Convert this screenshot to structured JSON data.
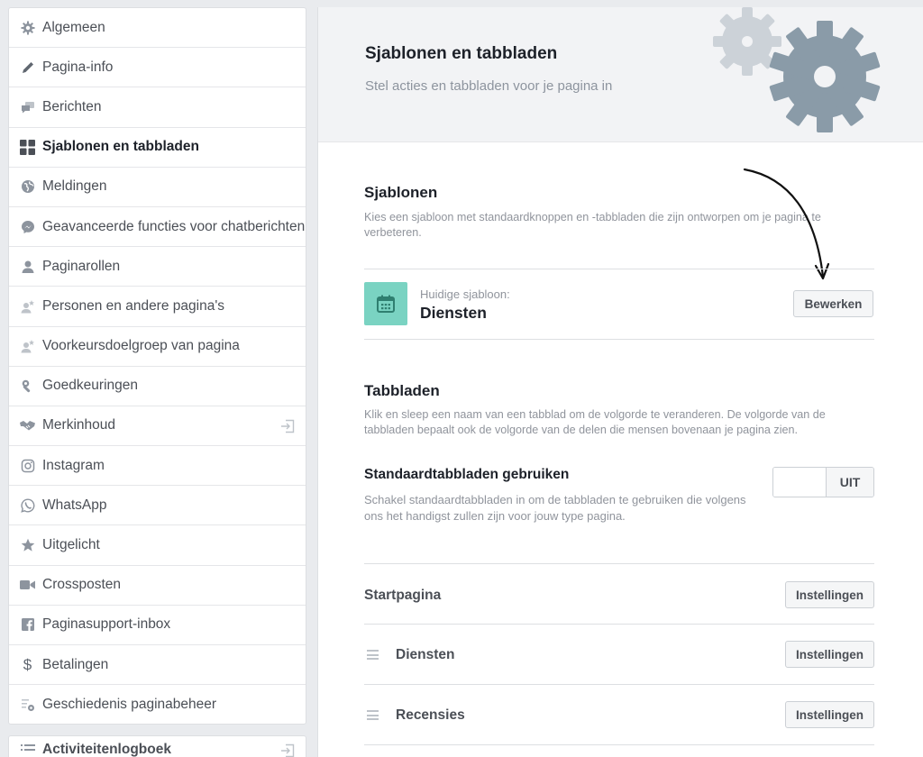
{
  "sidebar": {
    "items": [
      {
        "label": "Algemeen",
        "icon": "gear-icon"
      },
      {
        "label": "Pagina-info",
        "icon": "pencil-icon"
      },
      {
        "label": "Berichten",
        "icon": "chat-bubbles-icon"
      },
      {
        "label": "Sjablonen en tabbladen",
        "icon": "grid-icon",
        "active": true
      },
      {
        "label": "Meldingen",
        "icon": "globe-icon"
      },
      {
        "label": "Geavanceerde functies voor chatberichten",
        "icon": "messenger-icon"
      },
      {
        "label": "Paginarollen",
        "icon": "person-icon"
      },
      {
        "label": "Personen en andere pagina's",
        "icon": "person-star-icon"
      },
      {
        "label": "Voorkeursdoelgroep van pagina",
        "icon": "person-star-icon"
      },
      {
        "label": "Goedkeuringen",
        "icon": "wrench-icon"
      },
      {
        "label": "Merkinhoud",
        "icon": "handshake-icon",
        "trailing_icon": "export-icon"
      },
      {
        "label": "Instagram",
        "icon": "instagram-icon"
      },
      {
        "label": "WhatsApp",
        "icon": "whatsapp-icon"
      },
      {
        "label": "Uitgelicht",
        "icon": "star-icon"
      },
      {
        "label": "Crossposten",
        "icon": "video-camera-icon"
      },
      {
        "label": "Paginasupport-inbox",
        "icon": "facebook-icon"
      },
      {
        "label": "Betalingen",
        "icon": "dollar-icon"
      },
      {
        "label": "Geschiedenis paginabeheer",
        "icon": "history-gear-icon"
      }
    ],
    "secondary": {
      "label": "Activiteitenlogboek",
      "icon": "list-icon",
      "trailing_icon": "export-icon"
    }
  },
  "header": {
    "title": "Sjablonen en tabbladen",
    "subtitle": "Stel acties en tabbladen voor je pagina in"
  },
  "templates": {
    "title": "Sjablonen",
    "description": "Kies een sjabloon met standaardknoppen en -tabbladen die zijn ontworpen om je pagina te verbeteren.",
    "current_label": "Huidige sjabloon:",
    "current_name": "Diensten",
    "edit_button": "Bewerken"
  },
  "tabs": {
    "title": "Tabbladen",
    "description": "Klik en sleep een naam van een tabblad om de volgorde te veranderen. De volgorde van de tabbladen bepaalt ook de volgorde van de delen die mensen bovenaan je pagina zien.",
    "default_tabs": {
      "title": "Standaardtabbladen gebruiken",
      "description": "Schakel standaardtabbladen in om de tabbladen te gebruiken die volgens ons het handigst zullen zijn voor jouw type pagina.",
      "toggle_state": "UIT"
    },
    "list": [
      {
        "name": "Startpagina",
        "button": "Instellingen",
        "draggable": false
      },
      {
        "name": "Diensten",
        "button": "Instellingen",
        "draggable": true
      },
      {
        "name": "Recensies",
        "button": "Instellingen",
        "draggable": true
      }
    ]
  },
  "colors": {
    "accent_teal": "#7ad3c2",
    "gear_dark": "#8a9ba8",
    "gear_light": "#ccd2d8"
  }
}
